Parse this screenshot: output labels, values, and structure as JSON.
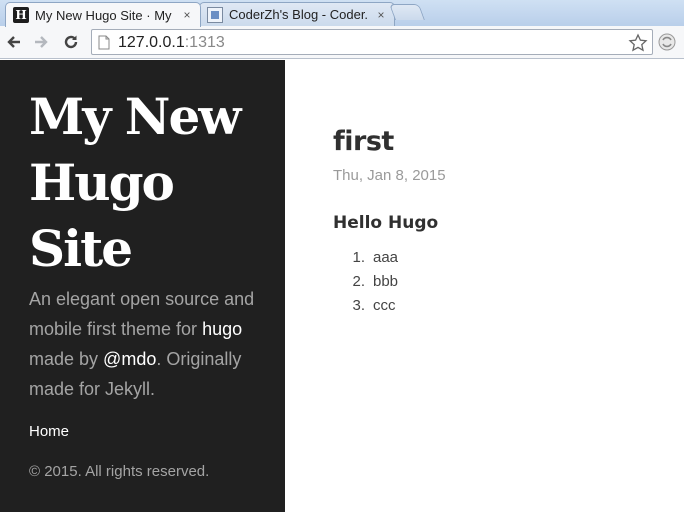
{
  "browser": {
    "tabs": [
      {
        "title": "My New Hugo Site · My",
        "favicon": "H",
        "active": true
      },
      {
        "title": "CoderZh's Blog - Coder.",
        "favicon": "blog-icon",
        "active": false
      }
    ],
    "tab_close": "×",
    "url_host": "127.0.0.1",
    "url_port": ":1313"
  },
  "sidebar": {
    "title_lines": [
      "My New",
      "Hugo",
      "Site"
    ],
    "lead_1": "An elegant open source and mobile first theme for ",
    "lead_link_hugo": "hugo",
    "lead_2": " made by ",
    "lead_link_mdo": "@mdo",
    "lead_3": ". Originally made for Jekyll.",
    "nav_home": "Home",
    "copyright": "© 2015. All rights reserved."
  },
  "post": {
    "title": "first",
    "date": "Thu, Jan 8, 2015",
    "heading": "Hello Hugo",
    "list": [
      {
        "num": "1.",
        "text": "aaa"
      },
      {
        "num": "2.",
        "text": "bbb"
      },
      {
        "num": "3.",
        "text": "ccc"
      }
    ]
  }
}
